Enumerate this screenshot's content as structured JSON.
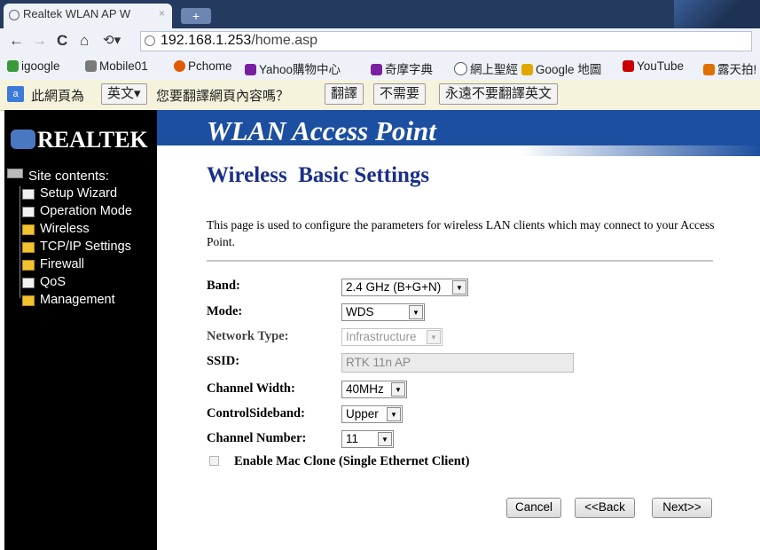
{
  "browser": {
    "tab_title": "Realtek WLAN AP W",
    "tab_close": "×",
    "new_tab": "+",
    "url_host": "192.168.1.253",
    "url_path": "/home.asp",
    "nav": {
      "back": "←",
      "forward": "→",
      "reload": "C",
      "home": "⌂",
      "history": "⟲▾"
    }
  },
  "bookmarks": [
    {
      "label": "igoogle",
      "color": "#3a9a3a"
    },
    {
      "label": "Mobile01",
      "color": "#7a7a7a"
    },
    {
      "label": "Pchome",
      "color": "#e05a00"
    },
    {
      "label": "Yahoo購物中心",
      "color": "#7a1fa2"
    },
    {
      "label": "奇摩字典",
      "color": "#7a1fa2"
    },
    {
      "label": "網上聖經",
      "color": "#555555"
    },
    {
      "label": "Google 地圖",
      "color": "#e0a800"
    },
    {
      "label": "YouTube",
      "color": "#cc0000"
    },
    {
      "label": "露天拍!",
      "color": "#e07000"
    }
  ],
  "translate_bar": {
    "icon": "a",
    "prefix": "此網頁為",
    "language_button": "英文▾",
    "question": "您要翻譯網頁內容嗎？",
    "translate_button": "翻譯",
    "no_button": "不需要",
    "never_button": "永遠不要翻譯英文"
  },
  "sidebar": {
    "logo_text": "REALTEK",
    "title": "Site contents:",
    "items": [
      {
        "label": "Setup Wizard",
        "icon": "page"
      },
      {
        "label": "Operation Mode",
        "icon": "page"
      },
      {
        "label": "Wireless",
        "icon": "folder"
      },
      {
        "label": "TCP/IP Settings",
        "icon": "folder"
      },
      {
        "label": "Firewall",
        "icon": "folder"
      },
      {
        "label": "QoS",
        "icon": "page"
      },
      {
        "label": "Management",
        "icon": "folder"
      }
    ]
  },
  "banner": {
    "title": "WLAN Access Point"
  },
  "main": {
    "heading": "Wireless  Basic Settings",
    "description": "This page is used to configure the parameters for wireless LAN clients which may connect to your Access Point.",
    "fields": {
      "band": {
        "label": "Band:",
        "value": "2.4 GHz (B+G+N)"
      },
      "mode": {
        "label": "Mode:",
        "value": "WDS"
      },
      "network_type": {
        "label": "Network Type:",
        "value": "Infrastructure"
      },
      "ssid": {
        "label": "SSID:",
        "value": "RTK 11n AP"
      },
      "channel_width": {
        "label": "Channel Width:",
        "value": "40MHz"
      },
      "control_sideband": {
        "label": "ControlSideband:",
        "value": "Upper"
      },
      "channel_number": {
        "label": "Channel Number:",
        "value": "11"
      }
    },
    "mac_clone": {
      "label": "Enable Mac Clone (Single Ethernet Client)",
      "checked": false,
      "disabled": true
    },
    "buttons": {
      "cancel": "Cancel",
      "back": "<<Back",
      "next": "Next>>"
    }
  },
  "colors": {
    "banner": "#1d4fa0",
    "heading": "#1b2f8a",
    "sidebar": "#000000"
  }
}
